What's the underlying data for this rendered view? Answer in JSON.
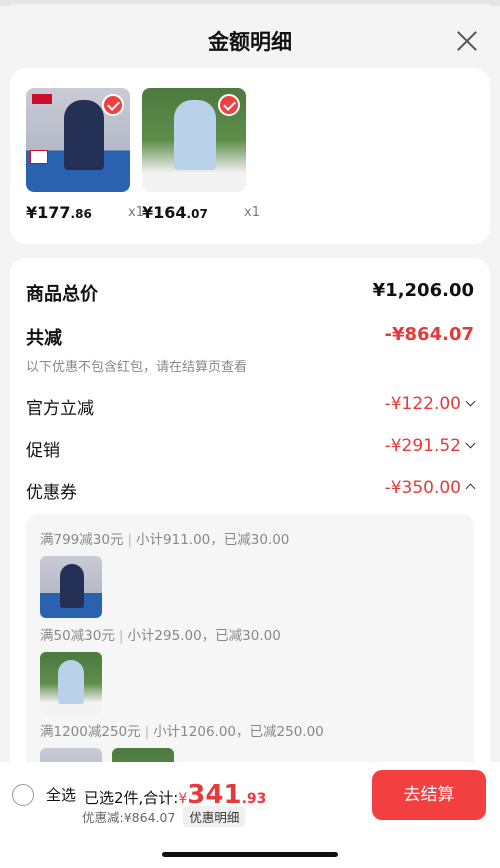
{
  "header": {
    "title": "金额明细"
  },
  "products": [
    {
      "price_int": "¥177",
      "price_dec": ".86",
      "qty": "x1"
    },
    {
      "price_int": "¥164",
      "price_dec": ".07",
      "qty": "x1"
    }
  ],
  "summary": {
    "total_label": "商品总价",
    "total_value": "¥1,206.00",
    "reduce_label": "共减",
    "reduce_value": "-¥864.07",
    "note": "以下优惠不包含红包，请在结算页查看",
    "official_label": "官方立减",
    "official_value": "-¥122.00",
    "promo_label": "促销",
    "promo_value": "-¥291.52",
    "coupon_label": "优惠券",
    "coupon_value": "-¥350.00"
  },
  "coupons": [
    {
      "rule": "满799减30元",
      "detail": "小计911.00，已减30.00"
    },
    {
      "rule": "满50减30元",
      "detail": "小计295.00，已减30.00"
    },
    {
      "rule": "满1200减250元",
      "detail": "小计1206.00，已减250.00"
    }
  ],
  "bottom": {
    "select_all": "全选",
    "selected_text": "已选2件,合计:",
    "total_yen": "¥",
    "total_int": "341",
    "total_dec": ".93",
    "discount_text": "优惠减:¥864.07",
    "detail_label": "优惠明细",
    "checkout_label": "去结算"
  },
  "colors": {
    "accent": "#f23f3f",
    "discount_red": "#e63a3a"
  }
}
